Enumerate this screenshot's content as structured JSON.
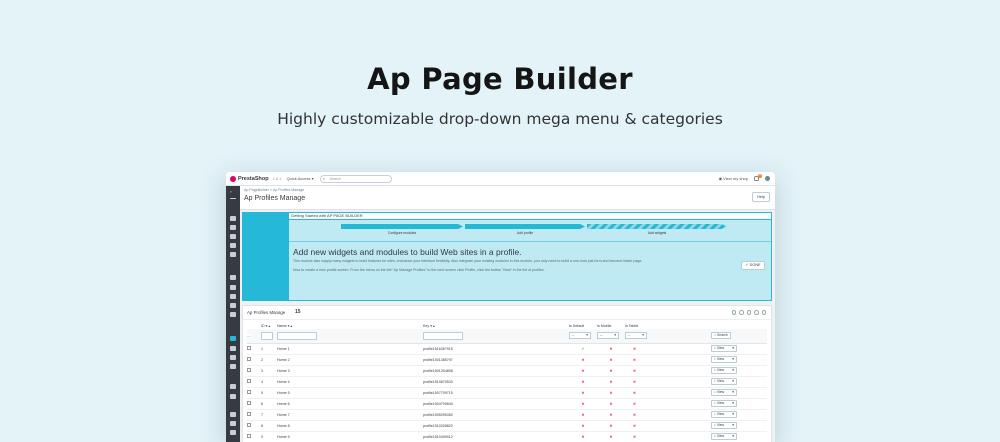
{
  "hero": {
    "title": "Ap Page Builder",
    "subtitle": "Highly customizable drop-down mega menu & categories"
  },
  "topbar": {
    "logo": "PrestaShop",
    "version": "1.6.1",
    "quick_access": "Quick Access ▾",
    "search_placeholder": "Search",
    "view_shop": "View my shop",
    "notification_count": "1"
  },
  "sidebar": {
    "toggle": "«",
    "icons": [
      "dashboard-icon",
      "orders-icon",
      "catalog-icon",
      "customers-icon",
      "messages-icon",
      "stats-icon",
      "modules-icon",
      "design-icon",
      "shipping-icon",
      "payment-icon",
      "localization-icon",
      "apbuilder-icon",
      "edit-icon",
      "star-icon",
      "blog-icon",
      "settings-icon",
      "tools-icon",
      "shop-icon",
      "monitor-icon",
      "image-icon"
    ]
  },
  "header": {
    "breadcrumb": "Ap PageBuilder  >  Ap Profiles Manage",
    "title": "Ap Profiles Manage",
    "help": "Help"
  },
  "panel": {
    "heading": "Getting Started with AP PAGE BUILDER",
    "steps": [
      "Configure modules",
      "Add profile",
      "Add widgets"
    ],
    "title": "Add new widgets and modules to build Web sites in a profile.",
    "body1": "This module also supply many widgets to build features for sites, enchance your interface flexibility. Also integrate your existing modules in this module, you only need to build a one-look just form and become faster page.",
    "body2": "Now to create a new profile screen. From the menu on the left \"Ap Manage Profiles\" to the next screen click Profile, click the button \"New\" in the list of profiles.",
    "done": "DONE"
  },
  "list": {
    "title": "Ap Profiles Manage",
    "count": "15",
    "columns": [
      "ID ▾ ▴",
      "Name ▾ ▴",
      "Key ▾ ▴",
      "Is Default",
      "Is Mobile",
      "Is Tablet"
    ],
    "filter_select": "--",
    "search_label": "Search",
    "view_label": "View",
    "rows": [
      {
        "id": "1",
        "name": "Home 1",
        "key": "profile1516367915",
        "def": "ok",
        "mob": "x",
        "tab": "x"
      },
      {
        "id": "2",
        "name": "Home 2",
        "key": "profile1501385797",
        "def": "x",
        "mob": "x",
        "tab": "x"
      },
      {
        "id": "3",
        "name": "Home 3",
        "key": "profile1501204808",
        "def": "x",
        "mob": "x",
        "tab": "x"
      },
      {
        "id": "4",
        "name": "Home 4",
        "key": "profile1519870533",
        "def": "x",
        "mob": "x",
        "tab": "x"
      },
      {
        "id": "5",
        "name": "Home 5",
        "key": "profile1507709715",
        "def": "x",
        "mob": "x",
        "tab": "x"
      },
      {
        "id": "6",
        "name": "Home 6",
        "key": "profile1504709840",
        "def": "x",
        "mob": "x",
        "tab": "x"
      },
      {
        "id": "7",
        "name": "Home 7",
        "key": "profile1505095350",
        "def": "x",
        "mob": "x",
        "tab": "x"
      },
      {
        "id": "8",
        "name": "Home 8",
        "key": "profile1510328820",
        "def": "x",
        "mob": "x",
        "tab": "x"
      },
      {
        "id": "9",
        "name": "Home 9",
        "key": "profile1510409012",
        "def": "x",
        "mob": "x",
        "tab": "x"
      }
    ]
  }
}
